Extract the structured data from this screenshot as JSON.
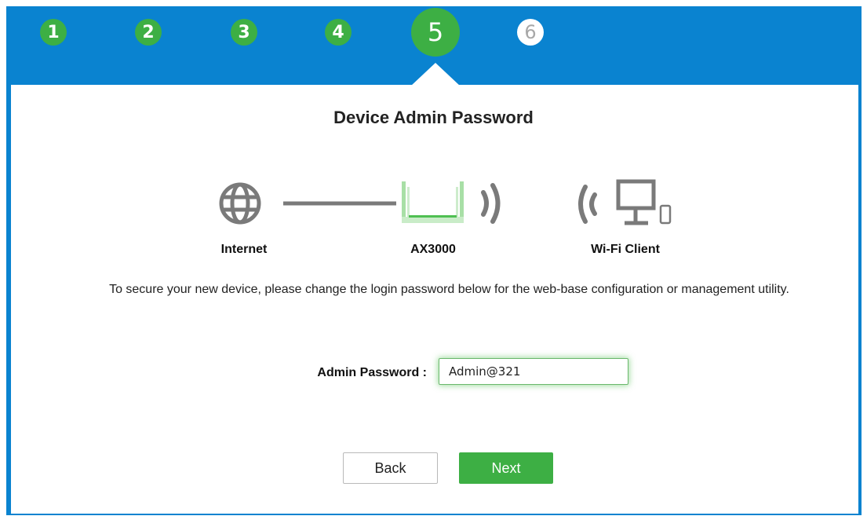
{
  "steps": [
    {
      "label": "1",
      "state": "done"
    },
    {
      "label": "2",
      "state": "done"
    },
    {
      "label": "3",
      "state": "done"
    },
    {
      "label": "4",
      "state": "done"
    },
    {
      "label": "5",
      "state": "current"
    },
    {
      "label": "6",
      "state": "todo"
    }
  ],
  "page_title": "Device Admin Password",
  "diagram": {
    "internet_label": "Internet",
    "device_label": "AX3000",
    "client_label": "Wi-Fi Client",
    "icons": [
      "globe-icon",
      "router-icon",
      "wifi-signal-icon",
      "computer-icon",
      "phone-icon"
    ]
  },
  "description": "To secure your new device, please change the login password below for the web-base configuration or management utility.",
  "form": {
    "admin_password_label": "Admin Password :",
    "admin_password_value": "Admin@321"
  },
  "buttons": {
    "back": "Back",
    "next": "Next"
  },
  "colors": {
    "header_blue": "#0a83d0",
    "accent_green": "#3daf44"
  }
}
